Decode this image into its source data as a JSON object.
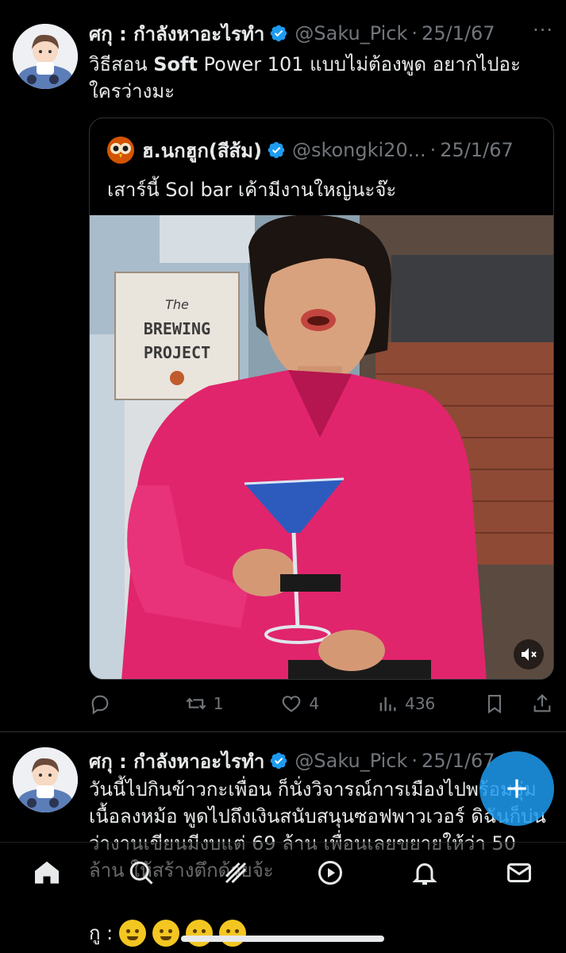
{
  "tweets": [
    {
      "author_name": "ศกุ : กำลังหาอะไรทำ",
      "handle": "@Saku_Pick",
      "separator": "·",
      "date": "25/1/67",
      "more_label": "···",
      "text_before": "วิธีสอน ",
      "text_bold": "Soft",
      "text_after": " Power 101 แบบไม่ต้องพูด  อยากไปอะใครว่างมะ",
      "quote": {
        "author_name": "ฮ.นกฮูก(สีส้ม)",
        "handle": "@skongki20...",
        "separator": "·",
        "date": "25/1/67",
        "text": "เสาร์นี้ Sol bar เค้ามีงานใหญ่นะจ๊ะ",
        "video_sign_text": [
          "The",
          "BREWING",
          "PROJECT"
        ]
      },
      "actions": {
        "reply_count": "",
        "retweet_count": "1",
        "like_count": "4",
        "views_count": "436"
      }
    },
    {
      "author_name": "ศกุ : กำลังหาอะไรทำ",
      "handle": "@Saku_Pick",
      "separator": "·",
      "date": "25/1/67",
      "text": "วันนี้ไปกินข้าวกะเพื่อน ก็นั่งวิจารณ์การเมืองไปพร้อมจุ่มเนื้อลงหม้อ พูดไปถึงเงินสนับสนุนซอฟพาวเวอร์ ดิฉันก็บ่นว่างานเขียนมีงบแต่ 69 ล้าน เพื่อนเลยขยายให้ว่า 50 ล้าน ให้สร้างตึกด้วยจ้ะ",
      "last_line_label": "กู :"
    }
  ],
  "colors": {
    "background": "#000000",
    "text_primary": "#e7e9ea",
    "text_secondary": "#71767b",
    "accent": "#1d9bf0",
    "border": "#2f3336"
  },
  "icons": [
    "verified-badge-icon",
    "more-icon",
    "reply-icon",
    "retweet-icon",
    "like-icon",
    "views-icon",
    "bookmark-icon",
    "share-icon",
    "mute-icon",
    "compose-icon",
    "home-icon",
    "search-icon",
    "communities-icon",
    "spaces-icon",
    "notifications-icon",
    "messages-icon"
  ]
}
